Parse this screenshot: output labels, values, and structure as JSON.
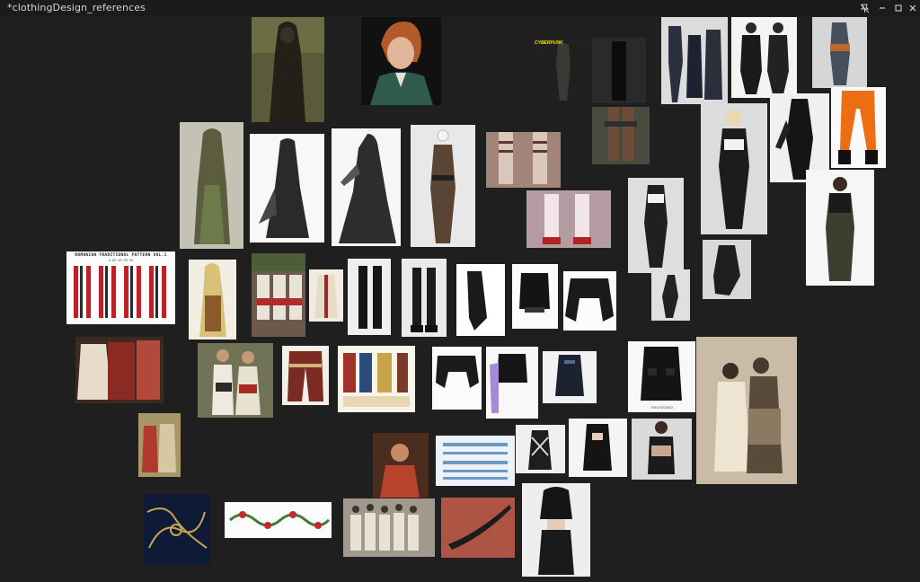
{
  "window": {
    "title": "*clothingDesign_references",
    "controls": {
      "pin_icon": "pin-off-icon",
      "minimize_icon": "minimize-icon",
      "maximize_icon": "maximize-icon",
      "close_icon": "close-icon"
    }
  },
  "canvas": {
    "background": "#1f1f1f"
  },
  "references": {
    "romanian_pattern": {
      "title": "ROMANIAN TRADITIONAL PATTERN VOL.1",
      "subtitle": "A.DE.VR.PR.PA"
    },
    "cyberpunk_logo": "CYBERPUNK",
    "vest_tag": "YOHJI STUDIO"
  }
}
